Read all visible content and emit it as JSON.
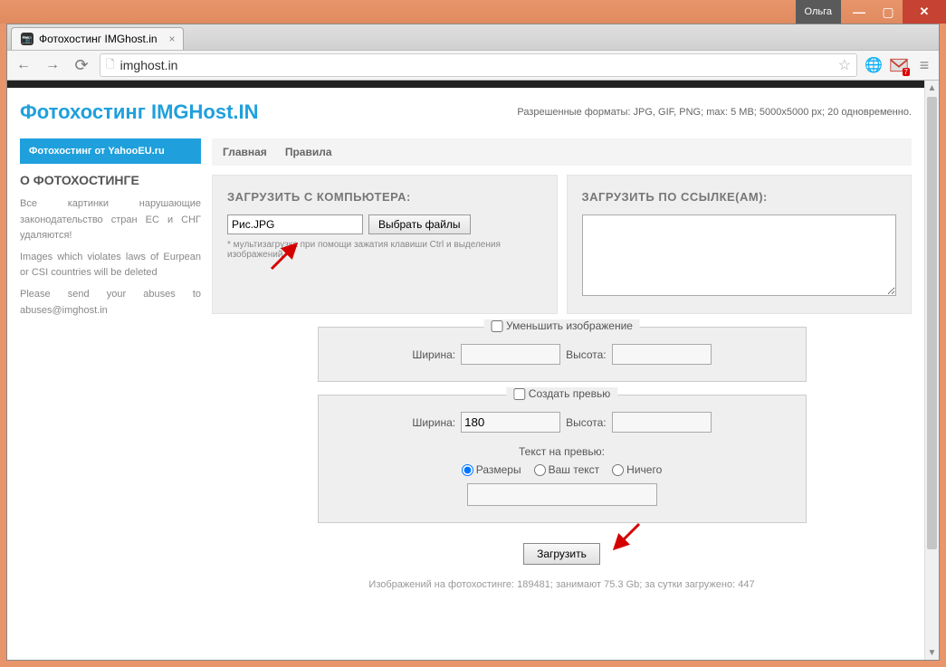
{
  "window": {
    "user": "Ольга"
  },
  "browser": {
    "tab_title": "Фотохостинг IMGhost.in",
    "url": "imghost.in",
    "gmail_badge": "7"
  },
  "page": {
    "title": "Фотохостинг IMGHost.IN",
    "allowed_formats": "Разрешенные форматы: JPG, GIF, PNG; max: 5 MB; 5000x5000 px; 20 одновременно."
  },
  "sidebar": {
    "header": "Фотохостинг от YahooEU.ru",
    "about_title": "О ФОТОХОСТИНГЕ",
    "p1": "Все картинки нарушающие законодательство стран ЕС и СНГ удаляются!",
    "p2": "Images which violates laws of Eurpean or CSI countries will be deleted",
    "p3": "Please send your abuses to abuses@imghost.in"
  },
  "nav": {
    "home": "Главная",
    "rules": "Правила"
  },
  "upload": {
    "computer_title": "ЗАГРУЗИТЬ С КОМПЬЮТЕРА:",
    "file_value": "Рис.JPG",
    "choose_files": "Выбрать файлы",
    "multi_hint": "* мультизагрузка при помощи зажатия клавиши Ctrl и выделения изображений",
    "url_title": "ЗАГРУЗИТЬ ПО ССЫЛКЕ(АМ):"
  },
  "resize": {
    "legend": "Уменьшить изображение",
    "width_label": "Ширина:",
    "height_label": "Высота:",
    "width_value": "",
    "height_value": ""
  },
  "preview": {
    "legend": "Создать превью",
    "width_label": "Ширина:",
    "height_label": "Высота:",
    "width_value": "180",
    "height_value": "",
    "text_label": "Текст на превью:",
    "opt_size": "Размеры",
    "opt_custom": "Ваш текст",
    "opt_none": "Ничего",
    "custom_text": ""
  },
  "submit": {
    "label": "Загрузить"
  },
  "footer": {
    "stats": "Изображений на фотохостинге: 189481; занимают 75.3 Gb; за сутки загружено: 447"
  }
}
